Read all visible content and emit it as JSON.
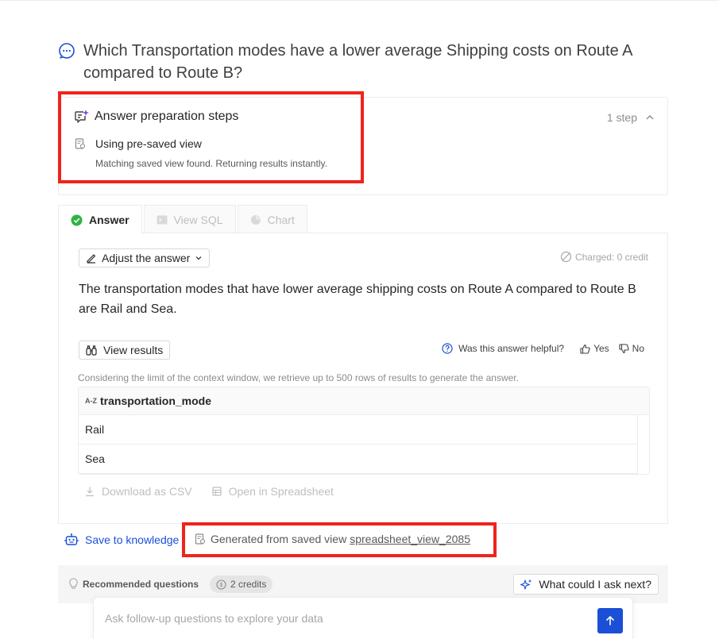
{
  "question": {
    "text": "Which Transportation modes have a lower average Shipping costs on Route A compared to Route B?",
    "icon": "chat-bubble-icon"
  },
  "steps": {
    "title": "Answer preparation steps",
    "count": "1 step",
    "items": [
      {
        "label": "Using pre-saved view",
        "description": "Matching saved view found. Returning results instantly."
      }
    ]
  },
  "tabs": [
    {
      "label": "Answer",
      "active": true
    },
    {
      "label": "View SQL",
      "active": false
    },
    {
      "label": "Chart",
      "active": false
    }
  ],
  "answer": {
    "adjust_label": "Adjust the answer",
    "charged": "Charged: 0 credit",
    "text": "The transportation modes that have lower average shipping costs on Route A compared to Route B are Rail and Sea.",
    "view_results_label": "View results",
    "helpful_question": "Was this answer helpful?",
    "yes_label": "Yes",
    "no_label": "No",
    "context_note": "Considering the limit of the context window, we retrieve up to 500 rows of results to generate the answer.",
    "table": {
      "column_type": "A-Z",
      "column": "transportation_mode",
      "rows": [
        "Rail",
        "Sea"
      ]
    },
    "download_csv": "Download as CSV",
    "open_spreadsheet": "Open in Spreadsheet"
  },
  "footer": {
    "save_knowledge": "Save to knowledge",
    "generated_prefix": "Generated from saved view",
    "generated_link": "spreadsheet_view_2085"
  },
  "recommend": {
    "label": "Recommended questions",
    "credits": "2 credits",
    "what_next": "What could I ask next?"
  },
  "followup": {
    "placeholder": "Ask follow-up questions to explore your data"
  },
  "colors": {
    "accent": "#1a4fd6",
    "success": "#2fb344",
    "highlight": "#f0231c"
  }
}
